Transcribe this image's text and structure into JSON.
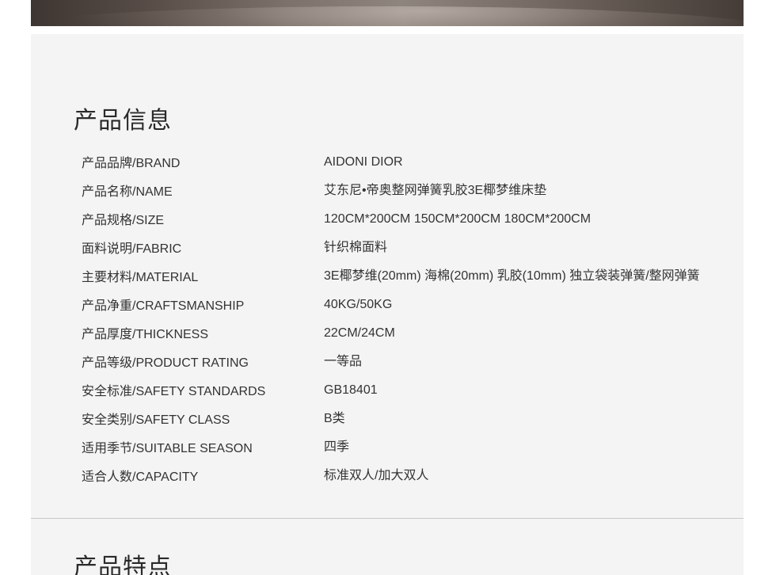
{
  "product_info": {
    "title": "产品信息",
    "rows": [
      {
        "label": "产品品牌/BRAND",
        "value": "AIDONI DIOR"
      },
      {
        "label": "产品名称/NAME",
        "value": "艾东尼•帝奥整网弹簧乳胶3E椰梦维床垫"
      },
      {
        "label": "产品规格/SIZE",
        "value": "120CM*200CM  150CM*200CM  180CM*200CM"
      },
      {
        "label": "面料说明/FABRIC",
        "value": "针织棉面料"
      },
      {
        "label": "主要材料/MATERIAL",
        "value": "3E椰梦维(20mm) 海棉(20mm) 乳胶(10mm)  独立袋装弹簧/整网弹簧"
      },
      {
        "label": "产品净重/CRAFTSMANSHIP",
        "value": "40KG/50KG"
      },
      {
        "label": "产品厚度/THICKNESS",
        "value": "22CM/24CM"
      },
      {
        "label": "产品等级/PRODUCT RATING",
        "value": "一等品"
      },
      {
        "label": "安全标准/SAFETY STANDARDS",
        "value": "GB18401"
      },
      {
        "label": "安全类别/SAFETY CLASS",
        "value": "B类"
      },
      {
        "label": "适用季节/SUITABLE SEASON",
        "value": "四季"
      },
      {
        "label": "适合人数/CAPACITY",
        "value": "标准双人/加大双人"
      }
    ]
  },
  "product_features": {
    "title": "产品特点"
  }
}
